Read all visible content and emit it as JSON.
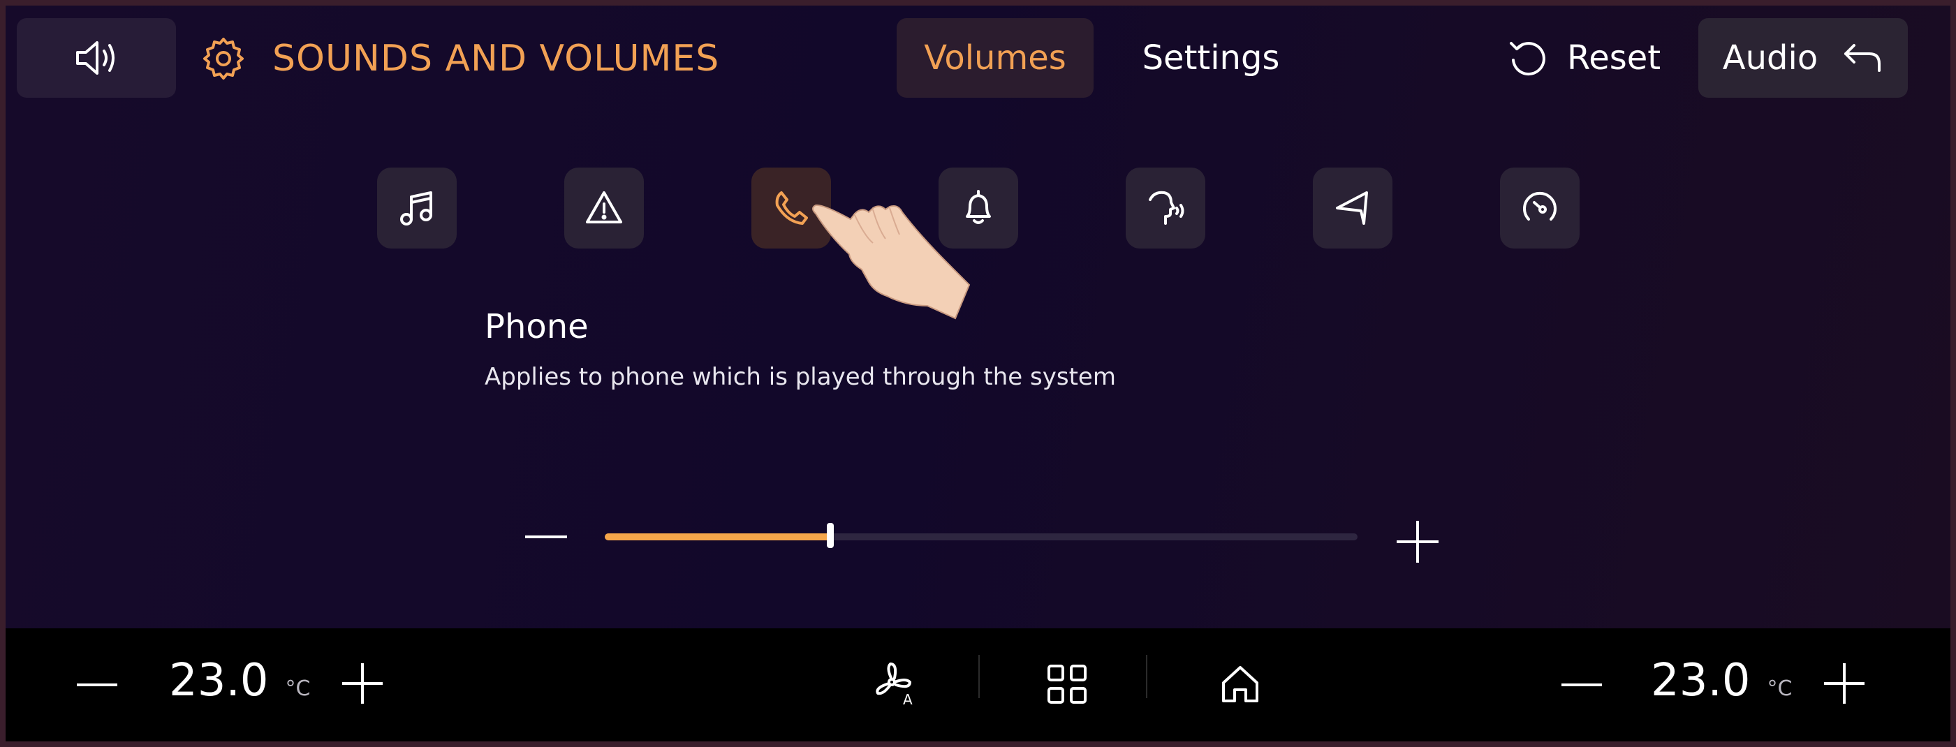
{
  "header": {
    "title": "SOUNDS AND VOLUMES",
    "tabs": [
      {
        "label": "Volumes",
        "active": true
      },
      {
        "label": "Settings",
        "active": false
      }
    ],
    "reset_label": "Reset",
    "audio_label": "Audio"
  },
  "categories": [
    {
      "name": "music",
      "icon": "music-note-icon",
      "active": false
    },
    {
      "name": "warning",
      "icon": "warning-triangle-icon",
      "active": false
    },
    {
      "name": "phone",
      "icon": "phone-icon",
      "active": true
    },
    {
      "name": "notifications",
      "icon": "bell-icon",
      "active": false
    },
    {
      "name": "voice",
      "icon": "voice-head-icon",
      "active": false
    },
    {
      "name": "navigation",
      "icon": "navigation-arrow-icon",
      "active": false
    },
    {
      "name": "gauge",
      "icon": "speedometer-icon",
      "active": false
    }
  ],
  "selected_category": {
    "title": "Phone",
    "description": "Applies to phone which is played through the system"
  },
  "volume": {
    "level": 0.3
  },
  "climate": {
    "left_temp": "23.0",
    "right_temp": "23.0",
    "unit": "°C"
  },
  "colors": {
    "accent": "#F2A154",
    "background": "#130A2A",
    "bar": "#000000",
    "button": "#271C37"
  }
}
